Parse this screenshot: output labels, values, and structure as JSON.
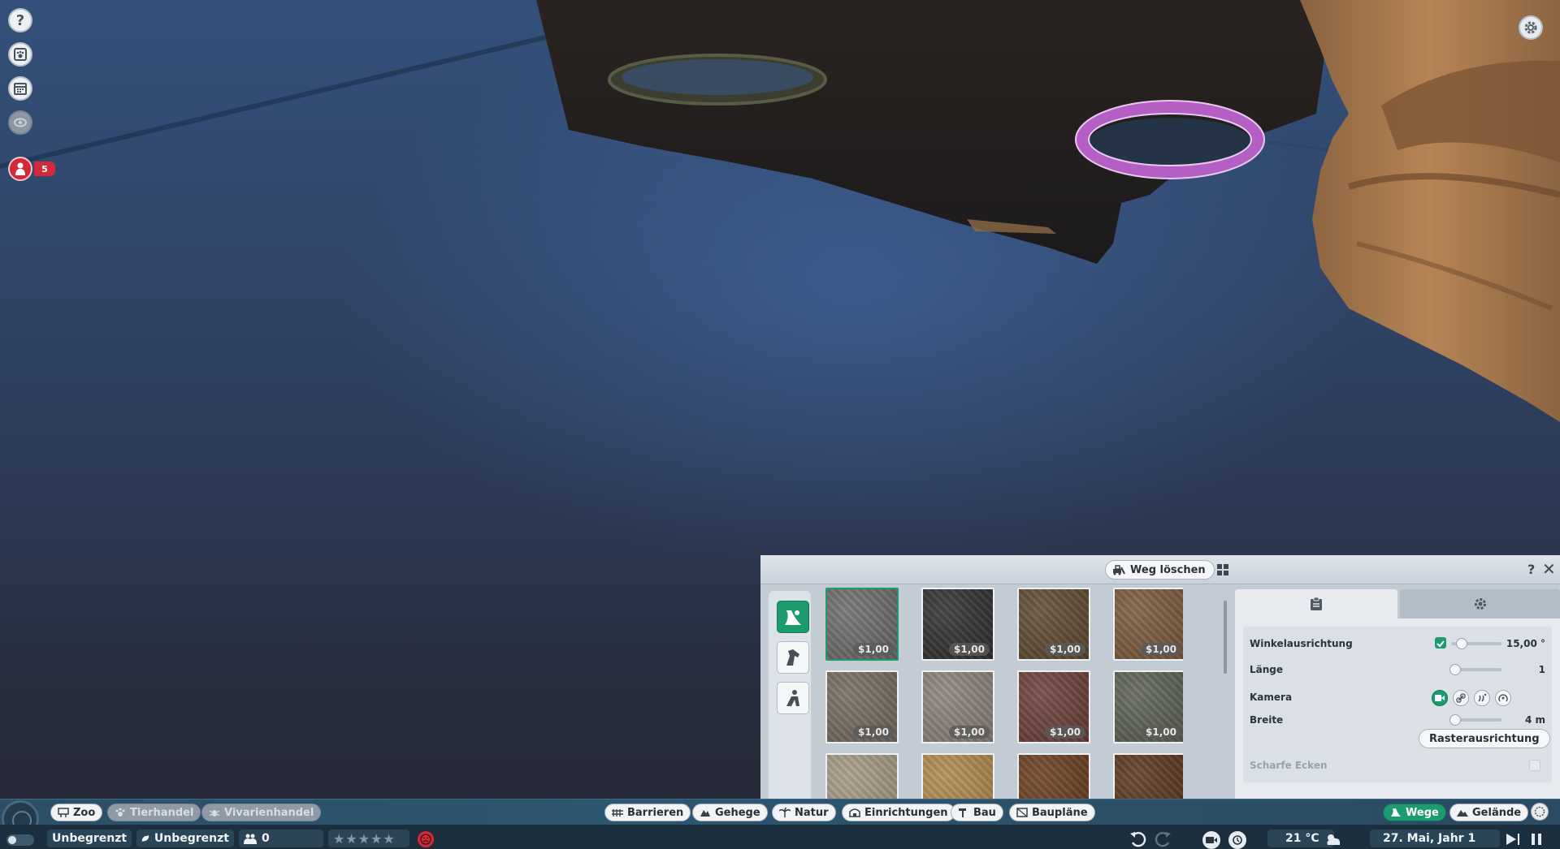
{
  "left_toolbar": {
    "help_label": "?",
    "guests_count": "5"
  },
  "panel": {
    "delete_path_label": "Weg löschen",
    "help_label": "?",
    "close_label": "✕",
    "swatches": [
      {
        "price": "$1,00",
        "color": "#6f6d6b",
        "selected": true
      },
      {
        "price": "$1,00",
        "color": "#2f2f2f"
      },
      {
        "price": "$1,00",
        "color": "#5e4930"
      },
      {
        "price": "$1,00",
        "color": "#7a5a3c"
      },
      {
        "price": "$1,00",
        "color": "#766b5f"
      },
      {
        "price": "$1,00",
        "color": "#8a8379"
      },
      {
        "price": "$1,00",
        "color": "#6b3f37"
      },
      {
        "price": "$1,00",
        "color": "#5c6155"
      },
      {
        "price": "",
        "color": "#a79a86"
      },
      {
        "price": "",
        "color": "#b08a4f"
      },
      {
        "price": "",
        "color": "#6a3d1f"
      },
      {
        "price": "",
        "color": "#5a361d"
      }
    ],
    "properties": {
      "angle_label": "Winkelausrichtung",
      "angle_value": "15,00 °",
      "length_label": "Länge",
      "length_value": "1",
      "camera_label": "Kamera",
      "width_label": "Breite",
      "width_value": "4 m",
      "grid_align_label": "Rasterausrichtung",
      "sharp_corners_label": "Scharfe Ecken"
    }
  },
  "bottom_bar": {
    "left_tabs": [
      "Zoo",
      "Tierhandel",
      "Vivarienhandel"
    ],
    "center_tabs": [
      "Barrieren",
      "Gehege",
      "Natur",
      "Einrichtungen",
      "Bau",
      "Baupläne"
    ],
    "right_tabs": [
      "Wege",
      "Gelände"
    ],
    "money": "Unbegrenzt",
    "conservation": "Unbegrenzt",
    "guests": "0",
    "temperature": "21 °C",
    "date": "27. Mai, Jahr 1"
  },
  "colors": {
    "accent_green": "#1d9a70",
    "alert_red": "#d22a3a",
    "selection_purple": "#b35fc4"
  }
}
